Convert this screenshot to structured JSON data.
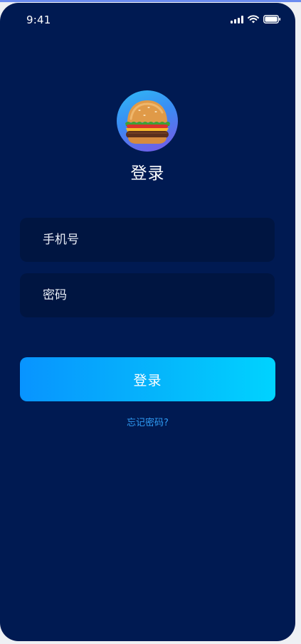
{
  "status_bar": {
    "time": "9:41",
    "icons": [
      "cellular-signal-icon",
      "wifi-icon",
      "battery-icon"
    ]
  },
  "login": {
    "avatar_icon": "burger-icon",
    "title": "登录",
    "phone_placeholder": "手机号",
    "password_placeholder": "密码",
    "submit_label": "登录",
    "forgot_password_label": "忘记密码?"
  },
  "colors": {
    "background": "#001a52",
    "field_background": "#001541",
    "button_gradient_start": "#0894ff",
    "button_gradient_end": "#00d3ff",
    "link": "#2f9cf5"
  }
}
